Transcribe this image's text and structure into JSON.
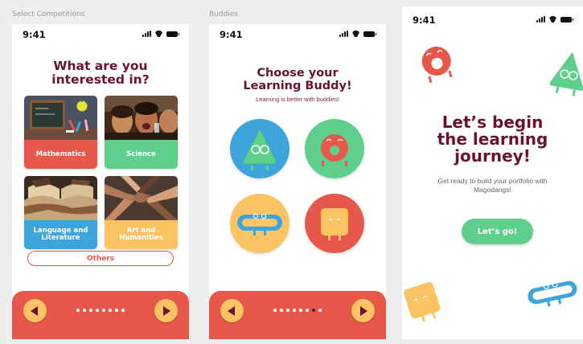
{
  "frames": [
    {
      "label": "Select Competitions"
    },
    {
      "label": "Buddies"
    }
  ],
  "status": {
    "time": "9:41"
  },
  "competitions": {
    "title_line1": "What are you",
    "title_line2": "interested in?",
    "cards": [
      {
        "label": "Mathematics",
        "color": "#e8584a"
      },
      {
        "label": "Science",
        "color": "#5fcf8d"
      },
      {
        "label_line1": "Language and",
        "label_line2": "Literature",
        "color": "#3ea5dc"
      },
      {
        "label_line1": "Art and",
        "label_line2": "Humanities",
        "color": "#fbc361"
      }
    ],
    "others_label": "Others"
  },
  "buddies": {
    "title_line1": "Choose your",
    "title_line2": "Learning Buddy!",
    "subtitle": "Learning is better with buddies!",
    "items": [
      {
        "name": "triangle-buddy",
        "bg": "#3ea5dc"
      },
      {
        "name": "donut-buddy",
        "bg": "#5fcf8d"
      },
      {
        "name": "capsule-buddy",
        "bg": "#fbc361"
      },
      {
        "name": "square-buddy",
        "bg": "#e8584a"
      }
    ]
  },
  "onboarding": {
    "title_line1": "Let’s begin",
    "title_line2": "the learning",
    "title_line3": "journey!",
    "subtitle": "Get ready to build your portfolio with Magodangs!",
    "cta_label": "Let’s go!"
  },
  "pagination": {
    "total": 8,
    "active_index": 6
  },
  "colors": {
    "accent": "#e8584a",
    "primary_text": "#6b1134",
    "green": "#5fcf8d",
    "blue": "#3ea5dc",
    "yellow": "#fbc361"
  }
}
